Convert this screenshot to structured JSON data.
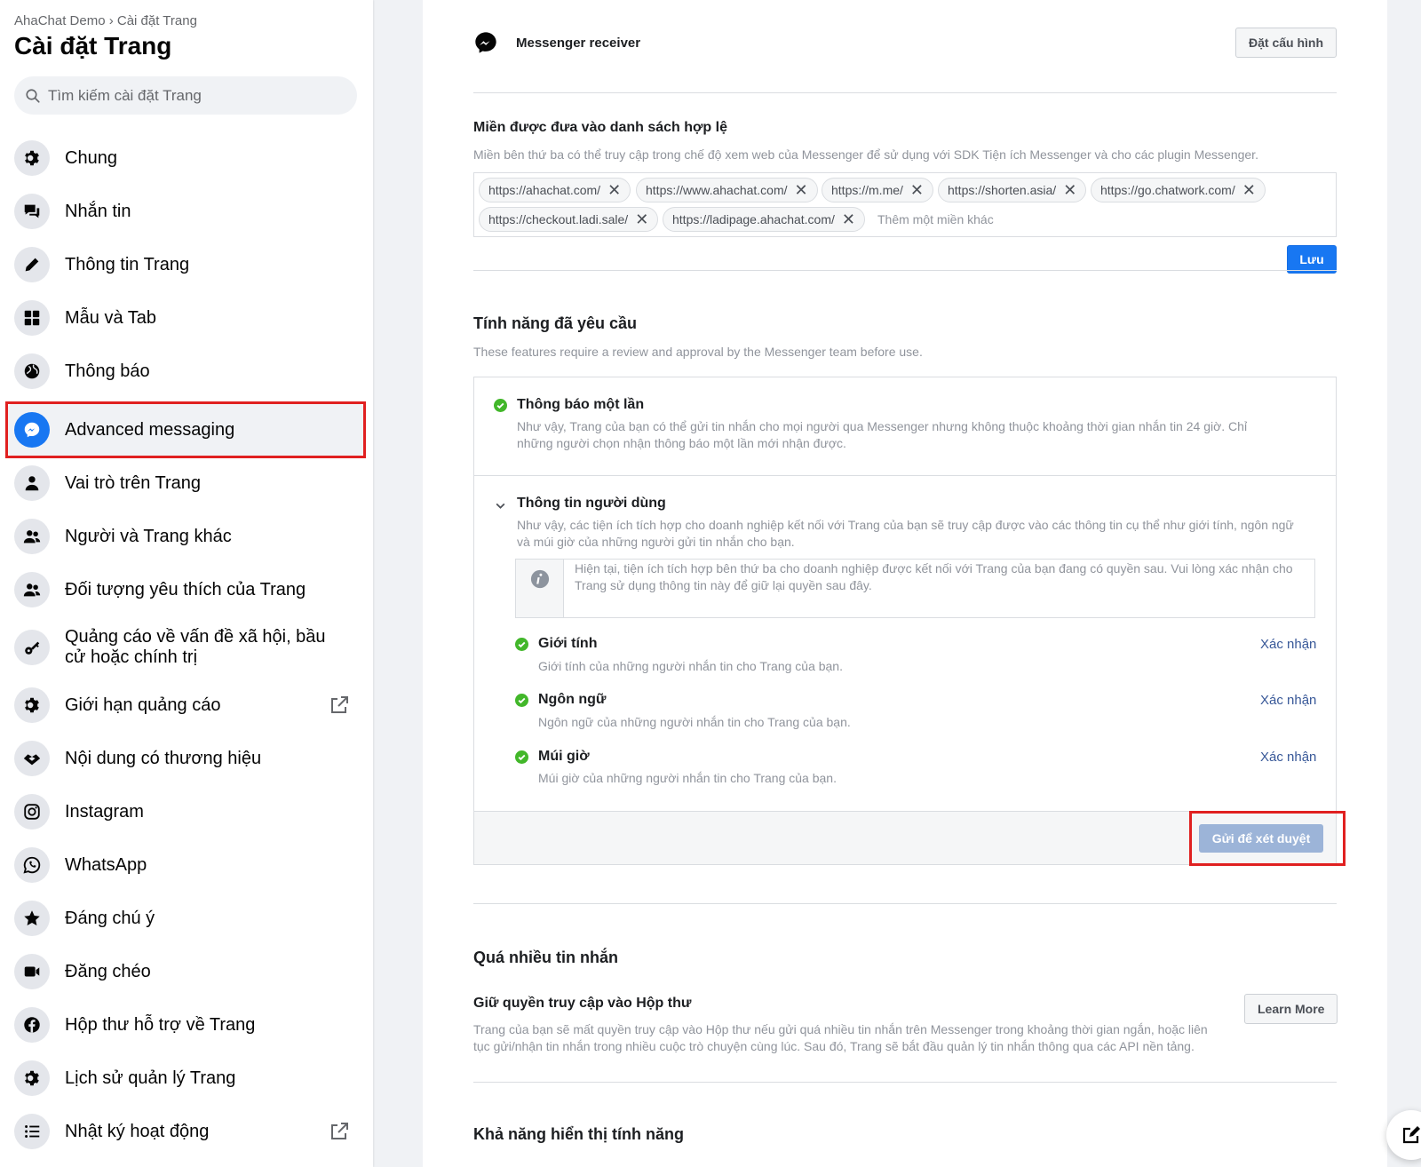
{
  "sidebar": {
    "breadcrumb": "AhaChat Demo › Cài đặt Trang",
    "title": "Cài đặt Trang",
    "search_placeholder": "Tìm kiếm cài đặt Trang",
    "items": [
      {
        "label": "Chung",
        "icon": "gear-icon"
      },
      {
        "label": "Nhắn tin",
        "icon": "chat-icon"
      },
      {
        "label": "Thông tin Trang",
        "icon": "pencil-icon"
      },
      {
        "label": "Mẫu và Tab",
        "icon": "grid-icon"
      },
      {
        "label": "Thông báo",
        "icon": "globe-icon"
      },
      {
        "label": "Advanced messaging",
        "icon": "messenger-icon"
      },
      {
        "label": "Vai trò trên Trang",
        "icon": "person-icon"
      },
      {
        "label": "Người và Trang khác",
        "icon": "people-icon"
      },
      {
        "label": "Đối tượng yêu thích của Trang",
        "icon": "people-icon"
      },
      {
        "label": "Quảng cáo về vấn đề xã hội, bầu cử hoặc chính trị",
        "icon": "key-icon"
      },
      {
        "label": "Giới hạn quảng cáo",
        "icon": "gear-icon"
      },
      {
        "label": "Nội dung có thương hiệu",
        "icon": "handshake-icon"
      },
      {
        "label": "Instagram",
        "icon": "instagram-icon"
      },
      {
        "label": "WhatsApp",
        "icon": "whatsapp-icon"
      },
      {
        "label": "Đáng chú ý",
        "icon": "star-icon"
      },
      {
        "label": "Đăng chéo",
        "icon": "video-icon"
      },
      {
        "label": "Hộp thư hỗ trợ về Trang",
        "icon": "facebook-icon"
      },
      {
        "label": "Lịch sử quản lý Trang",
        "icon": "gear-icon"
      },
      {
        "label": "Nhật ký hoạt động",
        "icon": "list-icon"
      }
    ]
  },
  "main": {
    "messenger_receiver": {
      "label": "Messenger receiver",
      "button": "Đặt cấu hình"
    },
    "whitelist": {
      "title": "Miền được đưa vào danh sách hợp lệ",
      "description": "Miền bên thứ ba có thể truy cập trong chế độ xem web của Messenger để sử dụng với SDK Tiện ích Messenger và cho các plugin Messenger.",
      "domains": [
        "https://ahachat.com/",
        "https://www.ahachat.com/",
        "https://m.me/",
        "https://shorten.asia/",
        "https://go.chatwork.com/",
        "https://checkout.ladi.sale/",
        "https://ladipage.ahachat.com/"
      ],
      "placeholder": "Thêm một miền khác",
      "save": "Lưu"
    },
    "features": {
      "title": "Tính năng đã yêu cầu",
      "description": "These features require a review and approval by the Messenger team before use.",
      "one_time": {
        "title": "Thông báo một lần",
        "description": "Như vậy, Trang của bạn có thể gửi tin nhắn cho mọi người qua Messenger nhưng không thuộc khoảng thời gian nhắn tin 24 giờ. Chỉ những người chọn nhận thông báo một lần mới nhận được."
      },
      "user_info": {
        "title": "Thông tin người dùng",
        "description": "Như vậy, các tiện ích tích hợp cho doanh nghiệp kết nối với Trang của bạn sẽ truy cập được vào các thông tin cụ thể như giới tính, ngôn ngữ và múi giờ của những người gửi tin nhắn cho bạn.",
        "info": "Hiện tại, tiện ích tích hợp bên thứ ba cho doanh nghiệp được kết nối với Trang của bạn đang có quyền sau. Vui lòng xác nhận cho Trang sử dụng thông tin này để giữ lại quyền sau đây.",
        "permissions": [
          {
            "title": "Giới tính",
            "description": "Giới tính của những người nhắn tin cho Trang của bạn.",
            "action": "Xác nhận"
          },
          {
            "title": "Ngôn ngữ",
            "description": "Ngôn ngữ của những người nhắn tin cho Trang của bạn.",
            "action": "Xác nhận"
          },
          {
            "title": "Múi giờ",
            "description": "Múi giờ của những người nhắn tin cho Trang của bạn.",
            "action": "Xác nhận"
          }
        ]
      },
      "submit": "Gửi để xét duyệt"
    },
    "too_many": {
      "title": "Quá nhiều tin nhắn",
      "subtitle": "Giữ quyền truy cập vào Hộp thư",
      "description": "Trang của bạn sẽ mất quyền truy cập vào Hộp thư nếu gửi quá nhiều tin nhắn trên Messenger trong khoảng thời gian ngắn, hoặc liên tục gửi/nhận tin nhắn trong nhiều cuộc trò chuyện cùng lúc. Sau đó, Trang sẽ bắt đầu quản lý tin nhắn thông qua các API nền tảng.",
      "button": "Learn More"
    },
    "visibility": {
      "title": "Khả năng hiển thị tính năng"
    }
  },
  "colors": {
    "accent": "#1877f2",
    "highlight": "#e02020",
    "check": "#42b72a"
  }
}
